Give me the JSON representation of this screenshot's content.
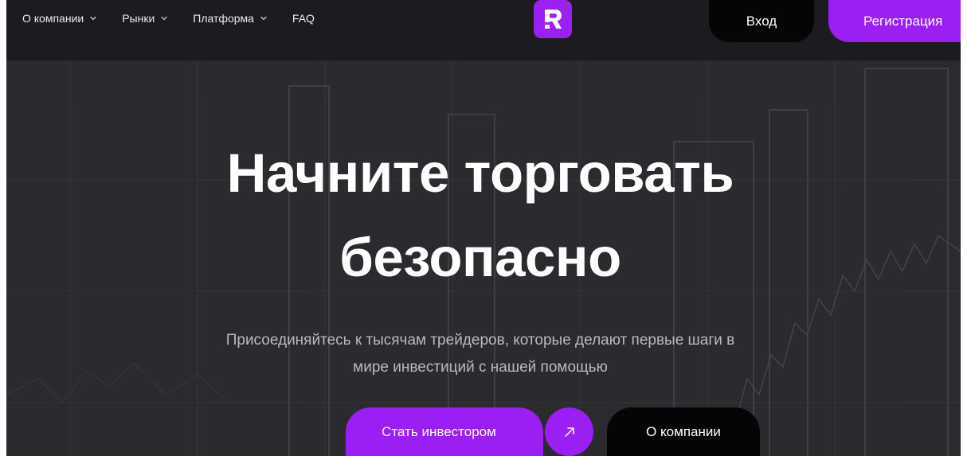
{
  "nav": {
    "items": [
      {
        "label": "О компании",
        "has_dropdown": true
      },
      {
        "label": "Рынки",
        "has_dropdown": true
      },
      {
        "label": "Платформа",
        "has_dropdown": true
      },
      {
        "label": "FAQ",
        "has_dropdown": false
      }
    ]
  },
  "header": {
    "logo_icon": "brand-r-icon",
    "login_label": "Вход",
    "register_label": "Регистрация"
  },
  "hero": {
    "title_line1": "Начните торговать",
    "title_line2": "безопасно",
    "subtitle_line1": "Присоединяйтесь к тысячам трейдеров, которые делают первые шаги в",
    "subtitle_line2": "мире инвестиций с нашей помощью",
    "primary_cta": "Стать инвестором",
    "arrow_icon": "arrow-up-right-icon",
    "secondary_cta": "О компании"
  },
  "colors": {
    "accent": "#9b1ef3",
    "background": "#2a2a2f",
    "header": "#1c1c20",
    "dark_button": "#050506"
  }
}
